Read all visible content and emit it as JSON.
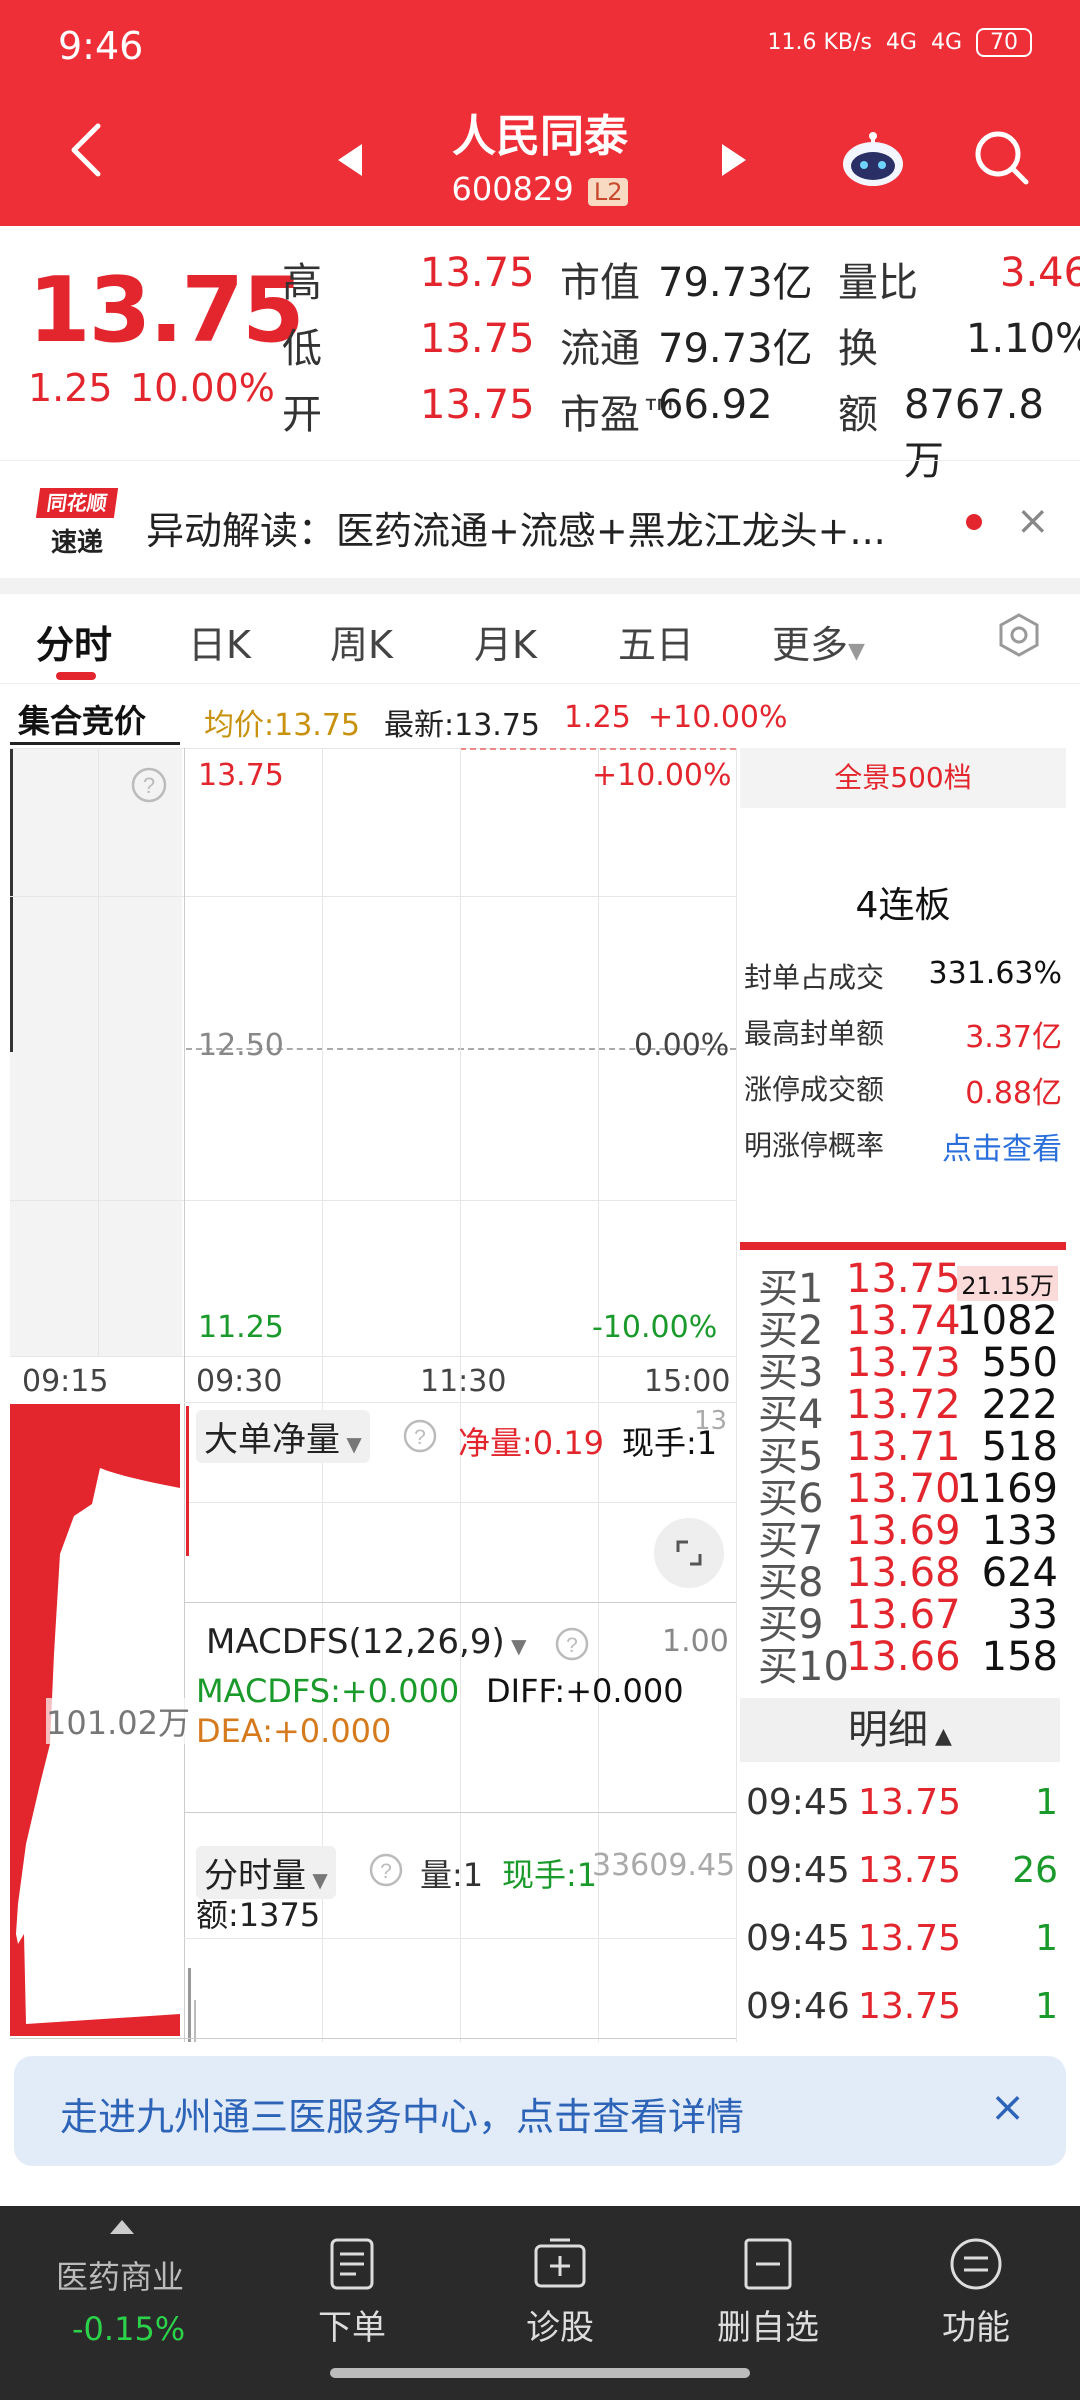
{
  "status": {
    "time": "9:46",
    "net_speed": "11.6 KB/s",
    "signal1": "4G",
    "signal2": "4G",
    "battery": "70"
  },
  "header": {
    "title": "人民同泰",
    "code": "600829",
    "level_badge": "L2"
  },
  "quote": {
    "price": "13.75",
    "change": "1.25",
    "change_pct": "10.00%",
    "rows": [
      {
        "l1": "高",
        "v1": "13.75",
        "l2": "市值",
        "v2": "79.73亿",
        "l3": "量比",
        "v3": "3.46"
      },
      {
        "l1": "低",
        "v1": "13.75",
        "l2": "流通",
        "v2": "79.73亿",
        "l3": "换",
        "v3": "1.10%"
      },
      {
        "l1": "开",
        "v1": "13.75",
        "l2": "市盈™",
        "v2": "66.92",
        "l3": "额",
        "v3": "8767.8万"
      }
    ]
  },
  "alert": {
    "logo_top": "同花顺",
    "logo_bottom": "速递",
    "text": "异动解读：医药流通+流感+黑龙江龙头+...",
    "close": "×"
  },
  "tabs": [
    "分时",
    "日K",
    "周K",
    "月K",
    "五日",
    "更多"
  ],
  "info_line": {
    "auction": "集合竞价",
    "avg": "均价:13.75",
    "latest": "最新:13.75",
    "chg": "1.25",
    "pct": "+10.00%"
  },
  "chart": {
    "top_price": "13.75",
    "top_pct": "+10.00%",
    "mid_price": "12.50",
    "mid_pct": "0.00%",
    "bot_price": "11.25",
    "bot_pct": "-10.00%",
    "times": [
      "09:15",
      "09:30",
      "11:30",
      "15:00"
    ],
    "auction_vol_label": "101.02万",
    "panel1": {
      "name": "大单净量",
      "net_label": "净量:0.19",
      "hand_label": "现手:1",
      "hand_sup": "13"
    },
    "panel2": {
      "name": "MACDFS(12,26,9)",
      "max": "1.00",
      "macd": "MACDFS:+0.000",
      "diff": "DIFF:+0.000",
      "dea": "DEA:+0.000"
    },
    "panel3": {
      "name": "分时量",
      "vol": "量:1",
      "hand": "现手:1",
      "top_val": "33609.45",
      "amount": "额:1375"
    }
  },
  "right_panel": {
    "levels_btn": "全景500档",
    "streak": "4连板",
    "stats": [
      {
        "label": "封单占成交",
        "value": "331.63%"
      },
      {
        "label": "最高封单额",
        "value": "3.37亿"
      },
      {
        "label": "涨停成交额",
        "value": "0.88亿"
      },
      {
        "label": "明涨停概率",
        "value": "点击查看"
      }
    ],
    "orderbook": [
      {
        "label": "买1",
        "price": "13.75",
        "vol": "21.15万"
      },
      {
        "label": "买2",
        "price": "13.74",
        "vol": "1082"
      },
      {
        "label": "买3",
        "price": "13.73",
        "vol": "550"
      },
      {
        "label": "买4",
        "price": "13.72",
        "vol": "222"
      },
      {
        "label": "买5",
        "price": "13.71",
        "vol": "518"
      },
      {
        "label": "买6",
        "price": "13.70",
        "vol": "1169"
      },
      {
        "label": "买7",
        "price": "13.69",
        "vol": "133"
      },
      {
        "label": "买8",
        "price": "13.68",
        "vol": "624"
      },
      {
        "label": "买9",
        "price": "13.67",
        "vol": "33"
      },
      {
        "label": "买10",
        "price": "13.66",
        "vol": "158"
      }
    ],
    "detail_title": "明细",
    "details": [
      {
        "time": "09:45",
        "price": "13.75",
        "vol": "1"
      },
      {
        "time": "09:45",
        "price": "13.75",
        "vol": "26"
      },
      {
        "time": "09:45",
        "price": "13.75",
        "vol": "1"
      },
      {
        "time": "09:46",
        "price": "13.75",
        "vol": "1"
      }
    ]
  },
  "banner": {
    "text": "走进九州通三医服务中心，点击查看详情",
    "close": "×"
  },
  "nav": {
    "sector": "医药商业",
    "sector_pct": "-0.15%",
    "items": [
      "下单",
      "诊股",
      "删自选",
      "功能"
    ]
  },
  "colors": {
    "up": "#e3262d",
    "down": "#1a9a2a",
    "header": "#ef2f37"
  }
}
